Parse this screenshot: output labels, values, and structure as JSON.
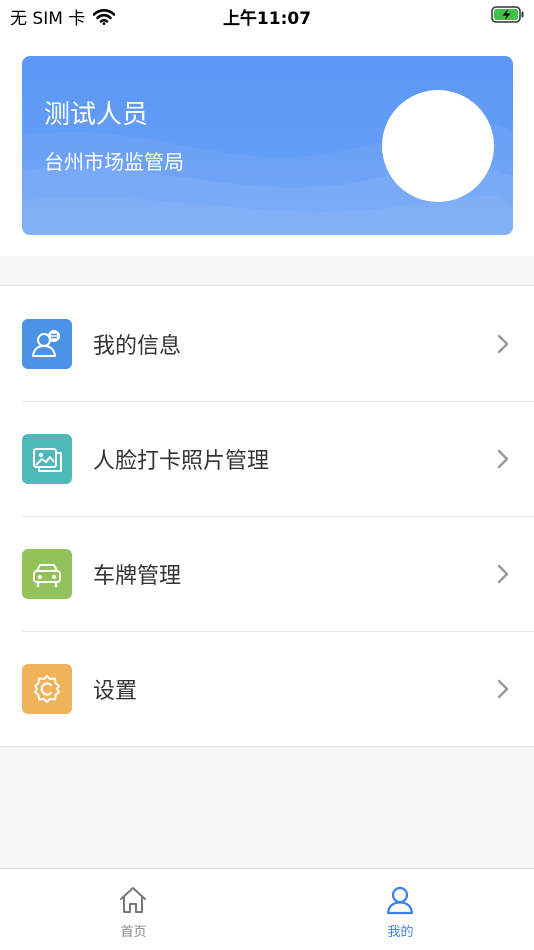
{
  "status_bar": {
    "carrier": "无 SIM 卡",
    "time": "上午11:07"
  },
  "profile": {
    "name": "测试人员",
    "org": "台州市场监管局"
  },
  "menu": [
    {
      "label": "我的信息",
      "icon": "user-info-icon",
      "color": "#4c93e6"
    },
    {
      "label": "人脸打卡照片管理",
      "icon": "photo-icon",
      "color": "#4fb8b8"
    },
    {
      "label": "车牌管理",
      "icon": "car-icon",
      "color": "#93c15a"
    },
    {
      "label": "设置",
      "icon": "gear-icon",
      "color": "#f0b25a"
    }
  ],
  "tabbar": {
    "home_label": "首页",
    "mine_label": "我的",
    "active": "mine",
    "active_color": "#3b82f0"
  }
}
